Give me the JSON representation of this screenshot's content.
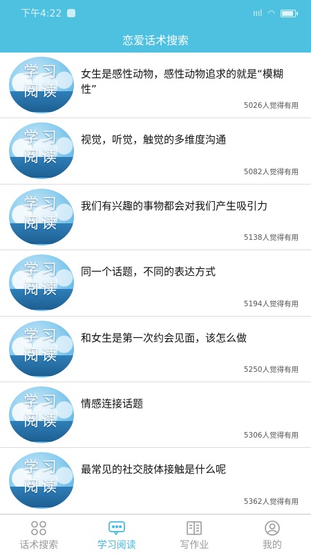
{
  "status_bar": {
    "time": "下午4:22",
    "signal": "ıııl",
    "battery_level": 0.8
  },
  "header": {
    "title": "恋爱话术搜索"
  },
  "thumbnail": {
    "line1": "学习",
    "line2": "阅读"
  },
  "items": [
    {
      "title": "女生是感性动物，感性动物追求的就是“模糊性”",
      "count": "5026人觉得有用"
    },
    {
      "title": "视觉，听觉，触觉的多维度沟通",
      "count": "5082人觉得有用"
    },
    {
      "title": "我们有兴趣的事物都会对我们产生吸引力",
      "count": "5138人觉得有用"
    },
    {
      "title": "同一个话题，不同的表达方式",
      "count": "5194人觉得有用"
    },
    {
      "title": "和女生是第一次约会见面，该怎么做",
      "count": "5250人觉得有用"
    },
    {
      "title": "情感连接话题",
      "count": "5306人觉得有用"
    },
    {
      "title": "最常见的社交肢体接触是什么呢",
      "count": "5362人觉得有用"
    }
  ],
  "tabs": [
    {
      "label": "话术搜索",
      "icon": "grid-icon",
      "active": false
    },
    {
      "label": "学习阅读",
      "icon": "chat-bubble-icon",
      "active": true
    },
    {
      "label": "写作业",
      "icon": "book-icon",
      "active": false
    },
    {
      "label": "我的",
      "icon": "user-icon",
      "active": false
    }
  ],
  "colors": {
    "primary": "#4ec1e1",
    "active_tab": "#42b9de",
    "inactive_tab": "#999999"
  }
}
